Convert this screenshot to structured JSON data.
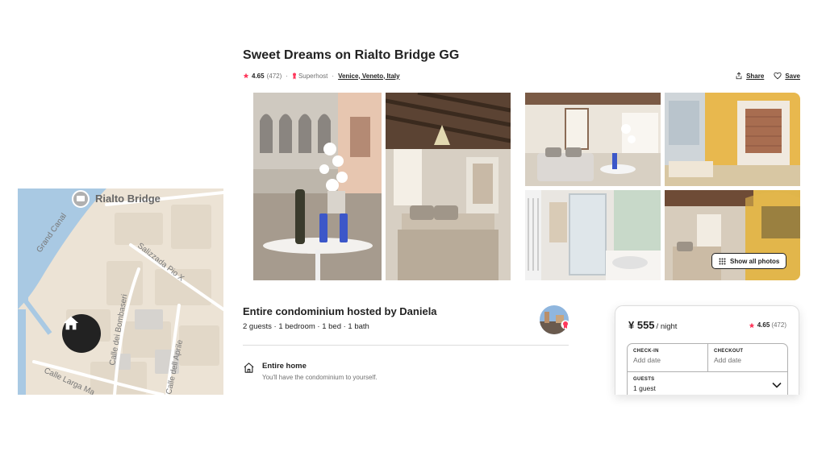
{
  "map": {
    "place_label": "Rialto Bridge",
    "streets": [
      "Grand Canal",
      "Salizzada Pio X",
      "Calle dei Bombaseri",
      "Calle Larga Ma",
      "Calle dell Aprile"
    ],
    "icon": "home-icon"
  },
  "listing": {
    "title": "Sweet Dreams on Rialto Bridge GG",
    "rating": "4.65",
    "reviews": "(472)",
    "separator": "·",
    "superhost": "Superhost",
    "location": "Venice, Veneto, Italy"
  },
  "actions": {
    "share": "Share",
    "save": "Save"
  },
  "gallery": {
    "show_all_label": "Show all photos"
  },
  "host": {
    "heading": "Entire condominium hosted by Daniela",
    "summary": "2 guests · 1 bedroom · 1 bed · 1 bath"
  },
  "highlights": [
    {
      "icon": "home-icon",
      "title": "Entire home",
      "description": "You'll have the condominium to yourself."
    }
  ],
  "booking": {
    "price": "¥ 555",
    "price_unit": "/ night",
    "rating": "4.65",
    "reviews": "(472)",
    "checkin_label": "CHECK-IN",
    "checkin_value": "Add date",
    "checkout_label": "CHECKOUT",
    "checkout_value": "Add date",
    "guests_label": "GUESTS",
    "guests_value": "1 guest"
  },
  "colors": {
    "accent": "#FF385C",
    "text": "#222222",
    "muted": "#717171",
    "border": "#DDDDDD",
    "water": "#A9C9E3"
  }
}
